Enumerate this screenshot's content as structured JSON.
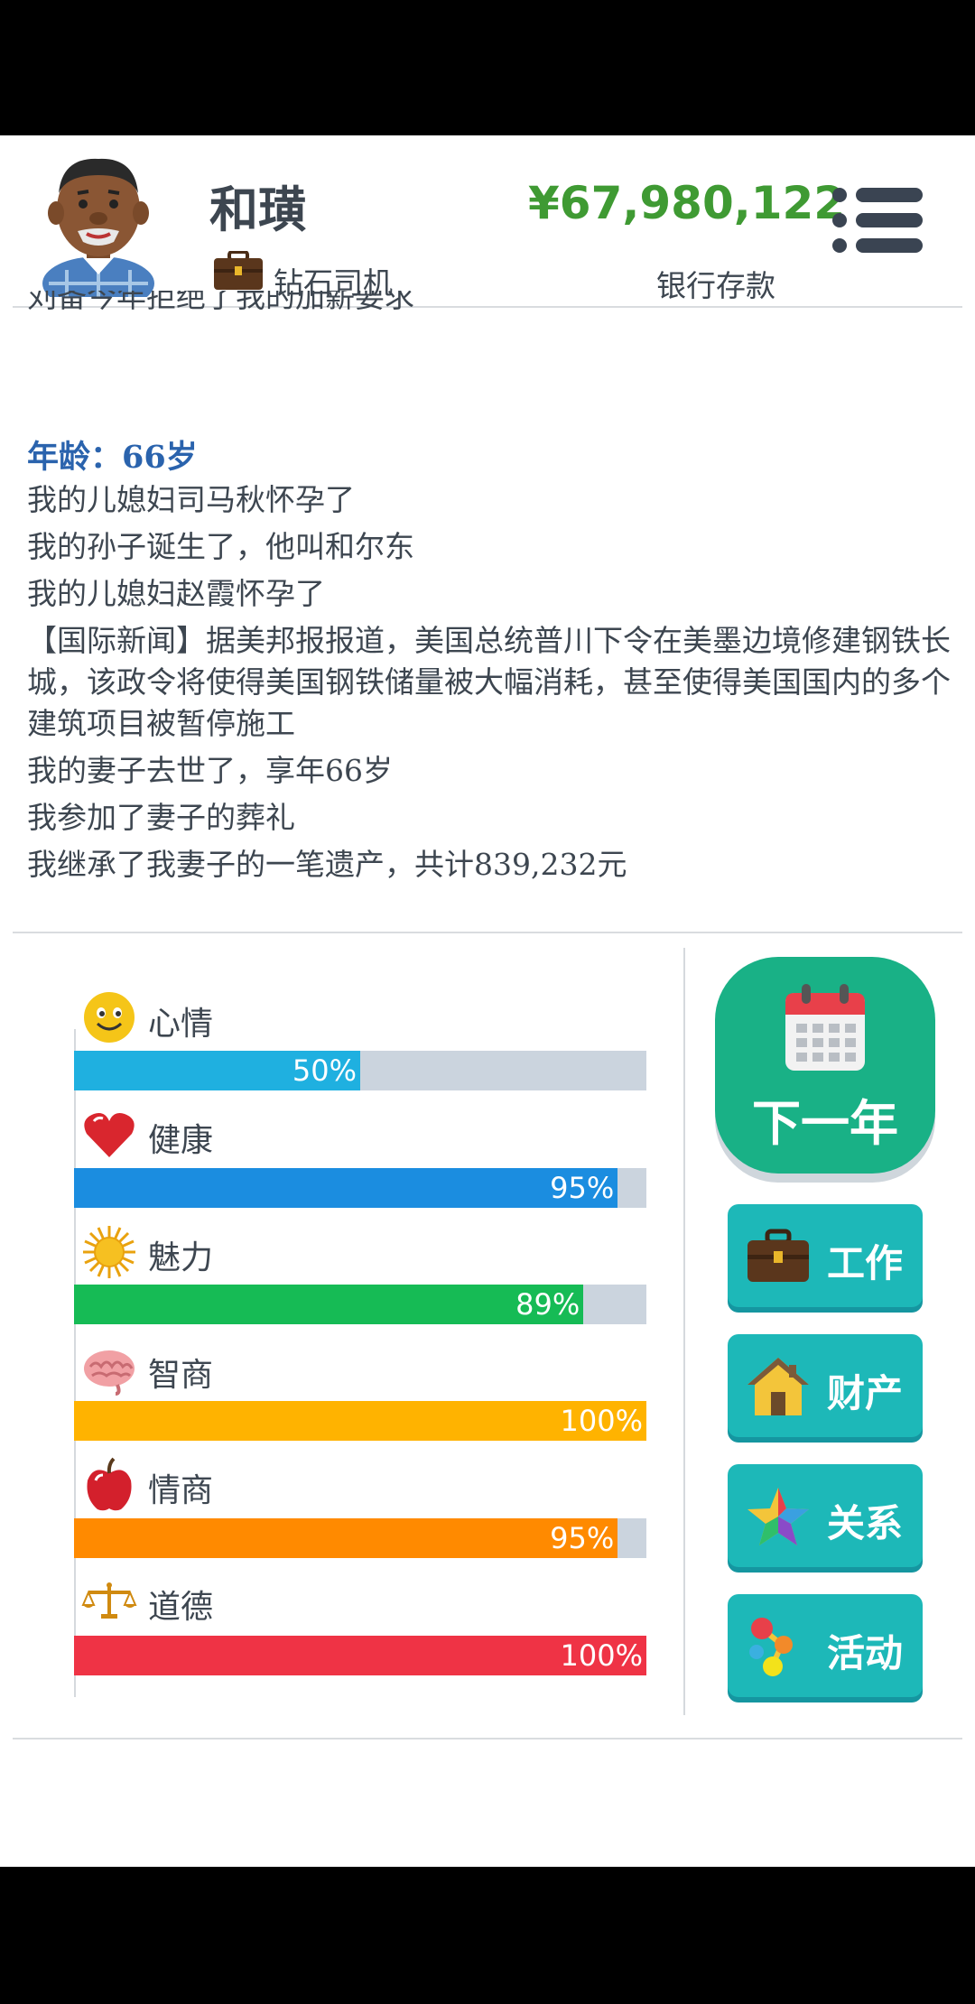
{
  "header": {
    "name": "和璜",
    "job": "钻石司机",
    "money": "¥67,980,122",
    "money_label": "银行存款",
    "menu_icon": "menu-icon"
  },
  "log": {
    "cut_line": "刘备今年拒绝了我的加薪要求",
    "age_line": "年龄：66岁",
    "lines": [
      "我的儿媳妇司马秋怀孕了",
      "我的孙子诞生了，他叫和尔东",
      "我的儿媳妇赵霞怀孕了",
      "【国际新闻】据美邦报报道，美国总统普川下令在美墨边境修建钢铁长城，该政令将使得美国钢铁储量被大幅消耗，甚至使得美国国内的多个建筑项目被暂停施工",
      "我的妻子去世了，享年66岁",
      "我参加了妻子的葬礼",
      "我继承了我妻子的一笔遗产，共计839,232元"
    ]
  },
  "stats": [
    {
      "label": "心情",
      "value": 0.5,
      "pct": "50%",
      "color": "#1fb0e0",
      "icon": "smiley-icon"
    },
    {
      "label": "健康",
      "value": 0.95,
      "pct": "95%",
      "color": "#1b8de0",
      "icon": "heart-icon"
    },
    {
      "label": "魅力",
      "value": 0.89,
      "pct": "89%",
      "color": "#16bb55",
      "icon": "sun-icon"
    },
    {
      "label": "智商",
      "value": 1.0,
      "pct": "100%",
      "color": "#ffb300",
      "icon": "brain-icon"
    },
    {
      "label": "情商",
      "value": 0.95,
      "pct": "95%",
      "color": "#ff8a00",
      "icon": "apple-icon"
    },
    {
      "label": "道德",
      "value": 1.0,
      "pct": "100%",
      "color": "#ef3345",
      "icon": "scales-icon"
    }
  ],
  "buttons": {
    "next_year": "下一年",
    "work": "工作",
    "property": "财产",
    "relations": "关系",
    "activities": "活动"
  }
}
